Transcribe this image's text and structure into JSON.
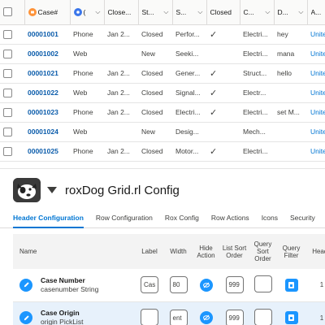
{
  "grid": {
    "headers": {
      "case_number": "Case#",
      "origin": "(",
      "closed_date": "Close...",
      "status": "St...",
      "subject": "S...",
      "closed": "Closed",
      "type": "C...",
      "description": "D...",
      "account": "A..."
    },
    "rows": [
      {
        "case": "00001001",
        "origin": "Phone",
        "date": "Jan 2...",
        "status": "Closed",
        "subject": "Perfor...",
        "closed": "✓",
        "type": "Electri...",
        "desc": "hey",
        "acct": "Unite"
      },
      {
        "case": "00001002",
        "origin": "Web",
        "date": "",
        "status": "New",
        "subject": "Seeki...",
        "closed": "",
        "type": "Electri...",
        "desc": "mana",
        "acct": "Unite"
      },
      {
        "case": "00001021",
        "origin": "Phone",
        "date": "Jan 2...",
        "status": "Closed",
        "subject": "Gener...",
        "closed": "✓",
        "type": "Struct...",
        "desc": "hello",
        "acct": "Unite"
      },
      {
        "case": "00001022",
        "origin": "Web",
        "date": "Jan 2...",
        "status": "Closed",
        "subject": "Signal...",
        "closed": "✓",
        "type": "Electr...",
        "desc": "",
        "acct": "Unite"
      },
      {
        "case": "00001023",
        "origin": "Phone",
        "date": "Jan 2...",
        "status": "Closed",
        "subject": "Electri...",
        "closed": "✓",
        "type": "Electri...",
        "desc": "set M...",
        "acct": "Unite"
      },
      {
        "case": "00001024",
        "origin": "Web",
        "date": "",
        "status": "New",
        "subject": "Desig...",
        "closed": "",
        "type": "Mech...",
        "desc": "",
        "acct": "Unite"
      },
      {
        "case": "00001025",
        "origin": "Phone",
        "date": "Jan 2...",
        "status": "Closed",
        "subject": "Motor...",
        "closed": "✓",
        "type": "Electri...",
        "desc": "",
        "acct": "Unite"
      }
    ]
  },
  "config": {
    "title": "roxDog Grid.rl Config",
    "tabs": [
      "Header Configuration",
      "Row Configuration",
      "Rox Config",
      "Row Actions",
      "Icons",
      "Security"
    ],
    "active_tab": 0,
    "table_headers": {
      "name": "Name",
      "label": "Label",
      "width": "Width",
      "hide_action": "Hide Action",
      "list_sort": "List Sort Order",
      "query_sort": "Query Sort Order",
      "query_filter": "Query Filter",
      "header": "Heade"
    },
    "rows": [
      {
        "label": "Case Number",
        "api": "casenumber String",
        "label_val": "Cas",
        "width_val": "80",
        "sort_val": "999",
        "query_sort_val": "",
        "num": "1"
      },
      {
        "label": "Case Origin",
        "api": "origin PickList",
        "label_val": "",
        "width_val": "ent",
        "sort_val": "999",
        "query_sort_val": "",
        "num": "1"
      }
    ]
  },
  "colors": {
    "accent": "#0176d3",
    "link": "#0b5cab",
    "icon_blue": "#1b96ff",
    "orange": "#fe9339",
    "selected_row": "#e7f1fb"
  }
}
